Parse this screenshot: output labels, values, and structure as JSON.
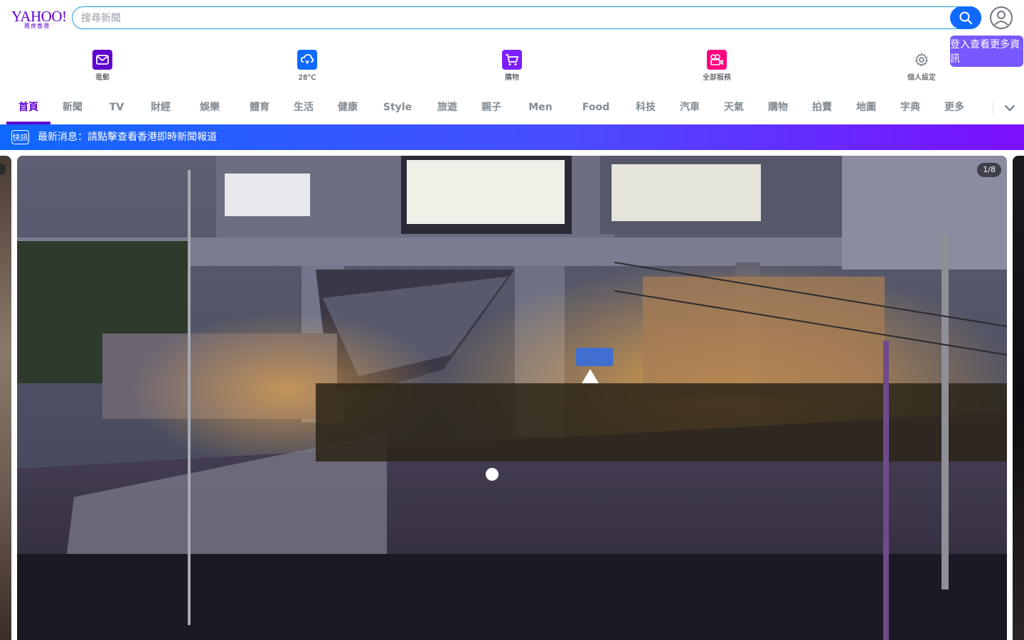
{
  "header": {
    "logo_text": "YAHOO!",
    "logo_subtext": "雅虎香港",
    "search": {
      "placeholder": "搜尋新聞",
      "value": ""
    },
    "search_icon": "search-icon",
    "profile_icon": "user-circle-icon",
    "signin_tooltip": "登入查看更多資訊"
  },
  "tiles": [
    {
      "label": "電郵",
      "icon": "mail-icon",
      "color": "#5f01d1"
    },
    {
      "label": "28°C",
      "icon": "weather-cloud-icon",
      "color": "#0f69ff"
    },
    {
      "label": "購物",
      "icon": "shopping-cart-icon",
      "color": "#7e1fff"
    },
    {
      "label": "全部服務",
      "icon": "video-camera-icon",
      "color": "#ff0080"
    },
    {
      "label": "個人設定",
      "icon": "gear-icon",
      "color": "#828c93"
    }
  ],
  "nav": {
    "items": [
      "首頁",
      "新聞",
      "TV",
      "財經",
      "娛樂",
      "體育",
      "生活",
      "健康",
      "Style",
      "旅遊",
      "親子",
      "Men",
      "Food",
      "科技",
      "汽車",
      "天氣",
      "購物",
      "拍賣",
      "地圖",
      "字典",
      "更多"
    ],
    "active_index": 0,
    "more_icon": "chevron-down-icon"
  },
  "banner": {
    "tag": "快訊",
    "text": "最新消息：請點擊查看香港即時新聞報道"
  },
  "carousel": {
    "counter": "1/8",
    "current": 1,
    "total": 8
  }
}
